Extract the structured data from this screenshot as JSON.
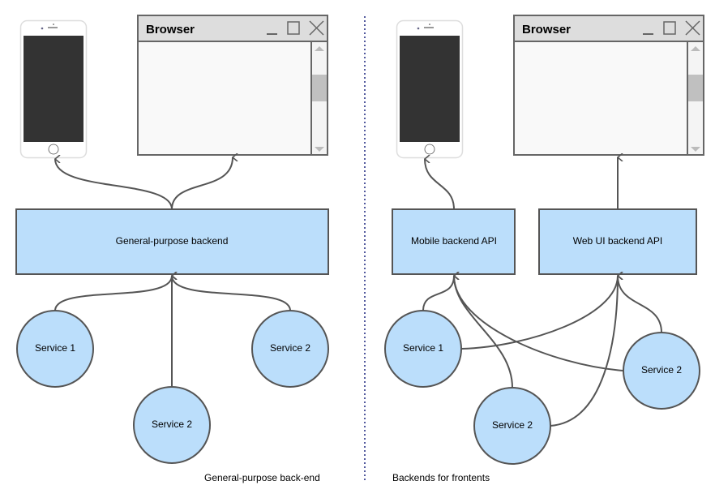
{
  "colors": {
    "node_fill": "#bbdefb",
    "stroke": "#555555",
    "divider": "#1a237e",
    "phone_screen": "#333333"
  },
  "left": {
    "browser_title": "Browser",
    "backend_label": "General-purpose backend",
    "services": [
      "Service 1",
      "Service 2",
      "Service 2"
    ],
    "caption": "General-purpose back-end"
  },
  "right": {
    "browser_title": "Browser",
    "mobile_api_label": "Mobile backend API",
    "web_api_label": "Web UI backend API",
    "services": [
      "Service 1",
      "Service 2",
      "Service 2"
    ],
    "caption": "Backends for frontents"
  }
}
